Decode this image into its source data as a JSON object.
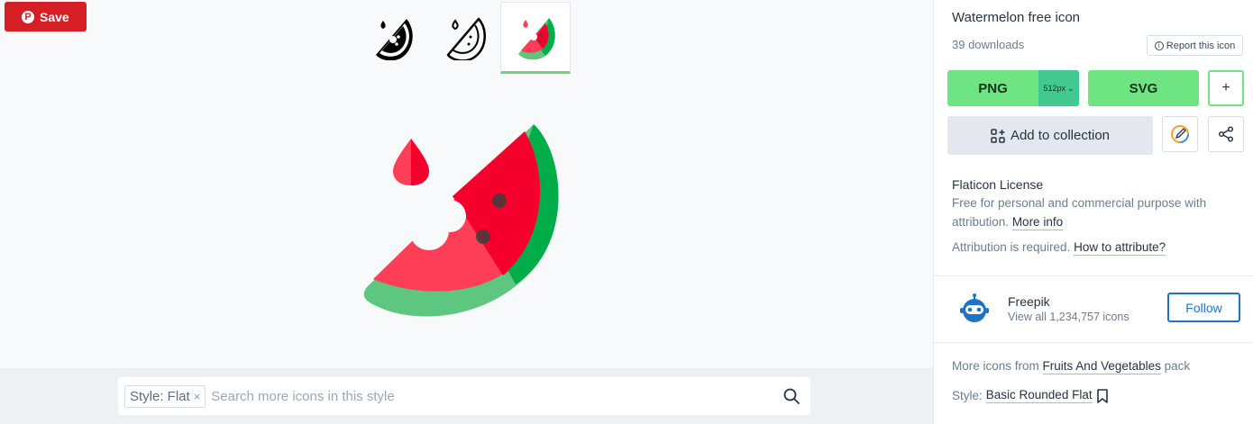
{
  "save_button": {
    "label": "Save",
    "pin_glyph": "P",
    "color": "#d61e25"
  },
  "variants": [
    {
      "name": "fill",
      "active": false
    },
    {
      "name": "lineal",
      "active": false
    },
    {
      "name": "flat",
      "active": true
    }
  ],
  "colors": {
    "accent_green": "#6ee483",
    "accent_teal": "#41c98f",
    "follow_blue": "#1f73c5",
    "melon_red": "#ff3e57",
    "melon_dark_red": "#f5002c",
    "rind_light": "#5dc77f",
    "rind_dark": "#00ad48"
  },
  "search": {
    "style_chip_label": "Style: Flat",
    "chip_close": "×",
    "placeholder": "Search more icons in this style"
  },
  "panel": {
    "title": "Watermelon free icon",
    "downloads": "39 downloads",
    "report_label": "Report this icon",
    "report_icon_glyph": "i",
    "png_label": "PNG",
    "png_size": "512px",
    "size_chevron": "⌄",
    "svg_label": "SVG",
    "plus_label": "+",
    "collection_label": "Add to collection",
    "license_title": "Flaticon License",
    "license_text": "Free for personal and commercial purpose with attribution.",
    "more_info": "More info",
    "attribution_text": "Attribution is required.",
    "how_to_attribute": "How to attribute?",
    "author_name": "Freepik",
    "author_sub": "View all 1,234,757 icons",
    "follow_label": "Follow",
    "more_icons_prefix": "More icons from",
    "pack_name": "Fruits And Vegetables",
    "more_icons_suffix": "pack",
    "style_prefix": "Style:",
    "style_name": "Basic Rounded Flat"
  }
}
